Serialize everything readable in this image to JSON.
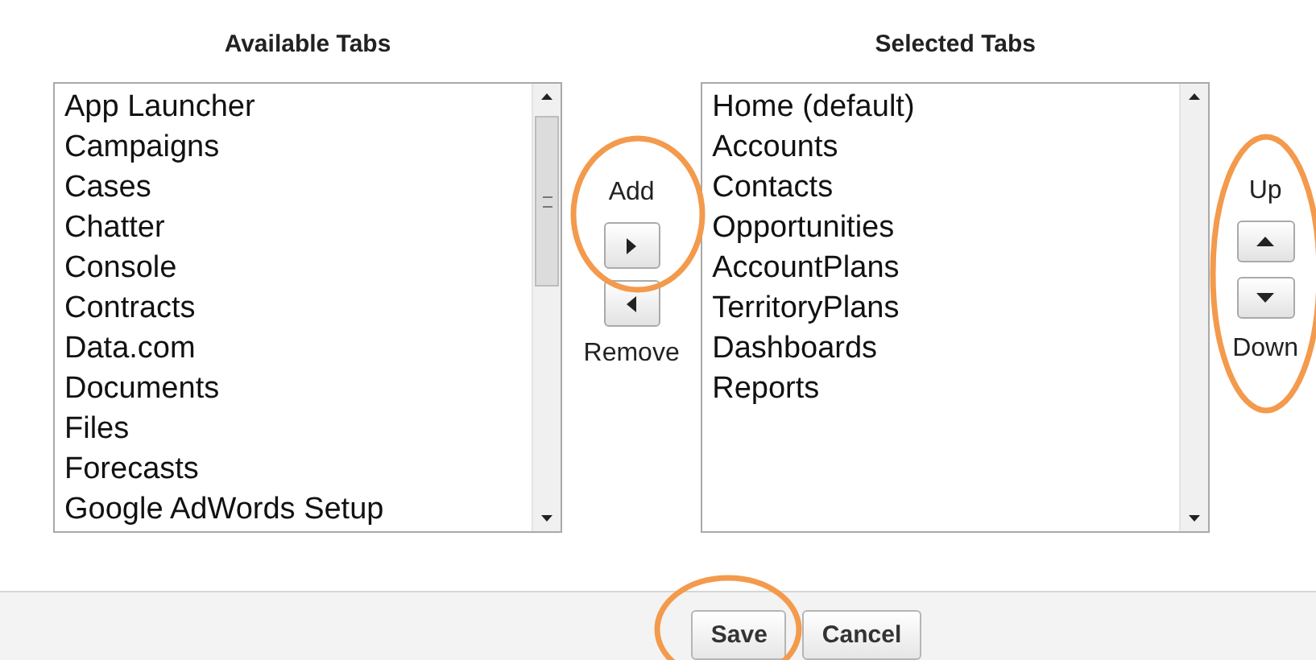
{
  "available_tabs": {
    "heading": "Available Tabs",
    "items": [
      {
        "label": "App Launcher",
        "selected": false
      },
      {
        "label": "Campaigns",
        "selected": false
      },
      {
        "label": "Cases",
        "selected": false
      },
      {
        "label": "Chatter",
        "selected": false
      },
      {
        "label": "Console",
        "selected": false
      },
      {
        "label": "Contracts",
        "selected": false
      },
      {
        "label": "Data.com",
        "selected": false
      },
      {
        "label": "Documents",
        "selected": false
      },
      {
        "label": "Files",
        "selected": false
      },
      {
        "label": "Forecasts",
        "selected": false
      },
      {
        "label": "Google AdWords Setup",
        "selected": false
      }
    ]
  },
  "add": {
    "label": "Add"
  },
  "remove": {
    "label": "Remove"
  },
  "selected_tabs": {
    "heading": "Selected Tabs",
    "items": [
      {
        "label": "Home (default)",
        "selected": false
      },
      {
        "label": "Accounts",
        "selected": false
      },
      {
        "label": "Contacts",
        "selected": false
      },
      {
        "label": "Opportunities",
        "selected": false
      },
      {
        "label": "AccountPlans",
        "selected": false
      },
      {
        "label": "TerritoryPlans",
        "selected": false
      },
      {
        "label": "Dashboards",
        "selected": false
      },
      {
        "label": "Reports",
        "selected": false
      }
    ]
  },
  "up": {
    "label": "Up"
  },
  "down": {
    "label": "Down"
  },
  "buttons": [
    "Save",
    "Cancel"
  ]
}
